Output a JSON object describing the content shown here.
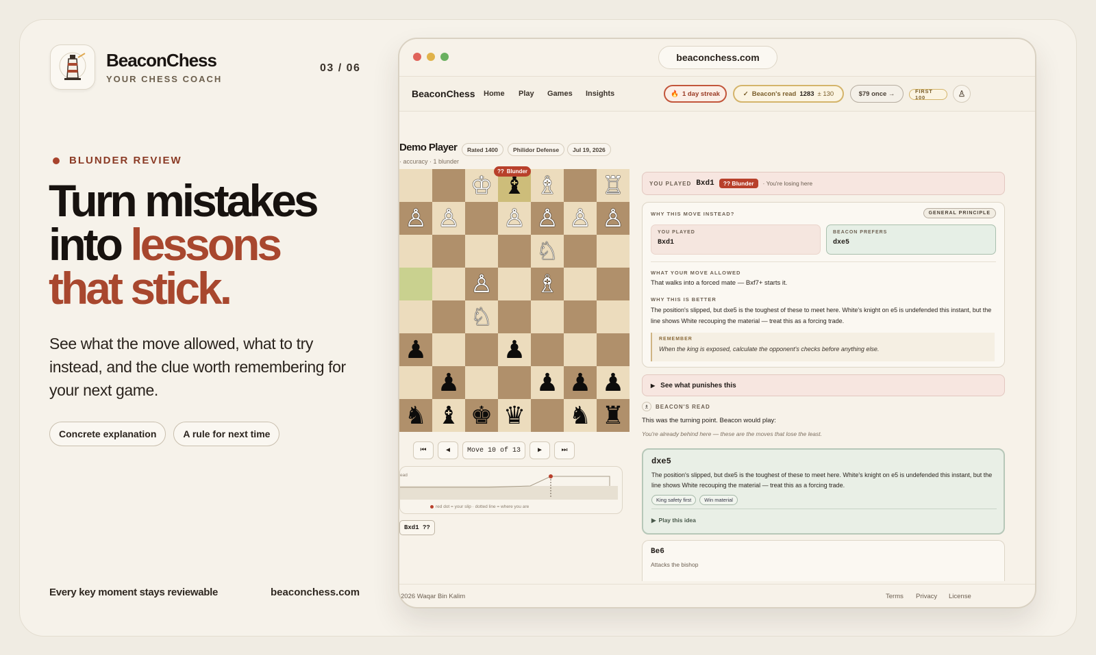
{
  "brand": {
    "name": "BeaconChess",
    "tagline": "YOUR CHESS COACH"
  },
  "pager": "03 / 06",
  "eyebrow": "BLUNDER REVIEW",
  "headline": {
    "line1": "Turn mistakes",
    "line2_plain": "into ",
    "line2_accent": "lessons",
    "line3_accent": "that stick."
  },
  "subtitle": "See what the move allowed, what to try instead, and the clue worth remembering for your next game.",
  "chips": [
    "Concrete explanation",
    "A rule for next time"
  ],
  "footer": {
    "line": "Every key moment stays reviewable",
    "url": "beaconchess.com"
  },
  "colors": {
    "accent": "#a8472e",
    "background": "#f6f2ea",
    "blunder": "#b8402b",
    "idea_green": "#e9efe6"
  },
  "browser": {
    "url": "beaconchess.com",
    "app": {
      "name": "BeaconChess",
      "nav": [
        "Home",
        "Play",
        "Games",
        "Insights"
      ],
      "streak": "1 day streak",
      "read_label": "Beacon's read",
      "read_value": "1283",
      "read_delta": "± 130",
      "price": "$79 once →",
      "badge": "FIRST 100",
      "avatar_icon": "pawn-icon"
    },
    "game": {
      "player": "Demo Player",
      "tags": [
        "Rated 1400",
        "Philidor Defense",
        "Jul 19, 2026"
      ],
      "accuracy": "· accuracy · 1 blunder",
      "marker_q": "??",
      "marker_label": "Blunder",
      "move_counter": "Move 10 of 13",
      "eval_label": "ead",
      "eval_caption": "red dot = your slip · dotted line = where you are",
      "move_chip": "Bxd1 ??"
    },
    "review": {
      "played_label": "YOU PLAYED",
      "played_move": "Bxd1",
      "blunder_tag": "?? Blunder",
      "losing": "· You're losing here",
      "why_label": "WHY THIS MOVE INSTEAD?",
      "principle": "GENERAL PRINCIPLE",
      "you_played_label": "YOU PLAYED",
      "you_played_move": "Bxd1",
      "prefers_label": "BEACON PREFERS",
      "prefers_move": "dxe5",
      "allowed_label": "WHAT YOUR MOVE ALLOWED",
      "allowed_text": "That walks into a forced mate — Bxf7+ starts it.",
      "better_label": "WHY THIS IS BETTER",
      "better_text": "The position's slipped, but dxe5 is the toughest of these to meet here. White's knight on e5 is undefended this instant, but the line shows White recouping the material — treat this as a forcing trade.",
      "remember_label": "REMEMBER",
      "remember_text": "When the king is exposed, calculate the opponent's checks before anything else.",
      "punish": "See what punishes this",
      "read_label": "BEACON'S READ",
      "read_line": "This was the turning point. Beacon would play:",
      "read_note": "You're already behind here — these are the moves that lose the least.",
      "idea_move": "dxe5",
      "idea_text": "The position's slipped, but dxe5 is the toughest of these to meet here. White's knight on e5 is undefended this instant, but the line shows White recouping the material — treat this as a forcing trade.",
      "idea_tags": [
        "King safety first",
        "Win material"
      ],
      "play_idea": "Play this idea",
      "idea2_move": "Be6",
      "idea2_text": "Attacks the bishop"
    },
    "footer": {
      "copyright": "2026 Waqar Bin Kalim",
      "links": [
        "Terms",
        "Privacy",
        "License"
      ]
    }
  },
  "board": [
    [
      "",
      "",
      "♔",
      "♝",
      "♗",
      "",
      "♖"
    ],
    [
      "♙",
      "♙",
      "",
      "♙",
      "♙",
      "♙",
      "♙"
    ],
    [
      "",
      "",
      "",
      "",
      "♘",
      "",
      ""
    ],
    [
      "",
      "",
      "♙",
      "",
      "♗",
      "",
      ""
    ],
    [
      "",
      "",
      "♘",
      "",
      "",
      "",
      ""
    ],
    [
      "♟",
      "",
      "",
      "♟",
      "",
      "",
      ""
    ],
    [
      "",
      "♟",
      "",
      "",
      "♟",
      "♟",
      "♟"
    ],
    [
      "♞",
      "♝",
      "♚",
      "♛",
      "",
      "♞",
      "♜"
    ]
  ]
}
